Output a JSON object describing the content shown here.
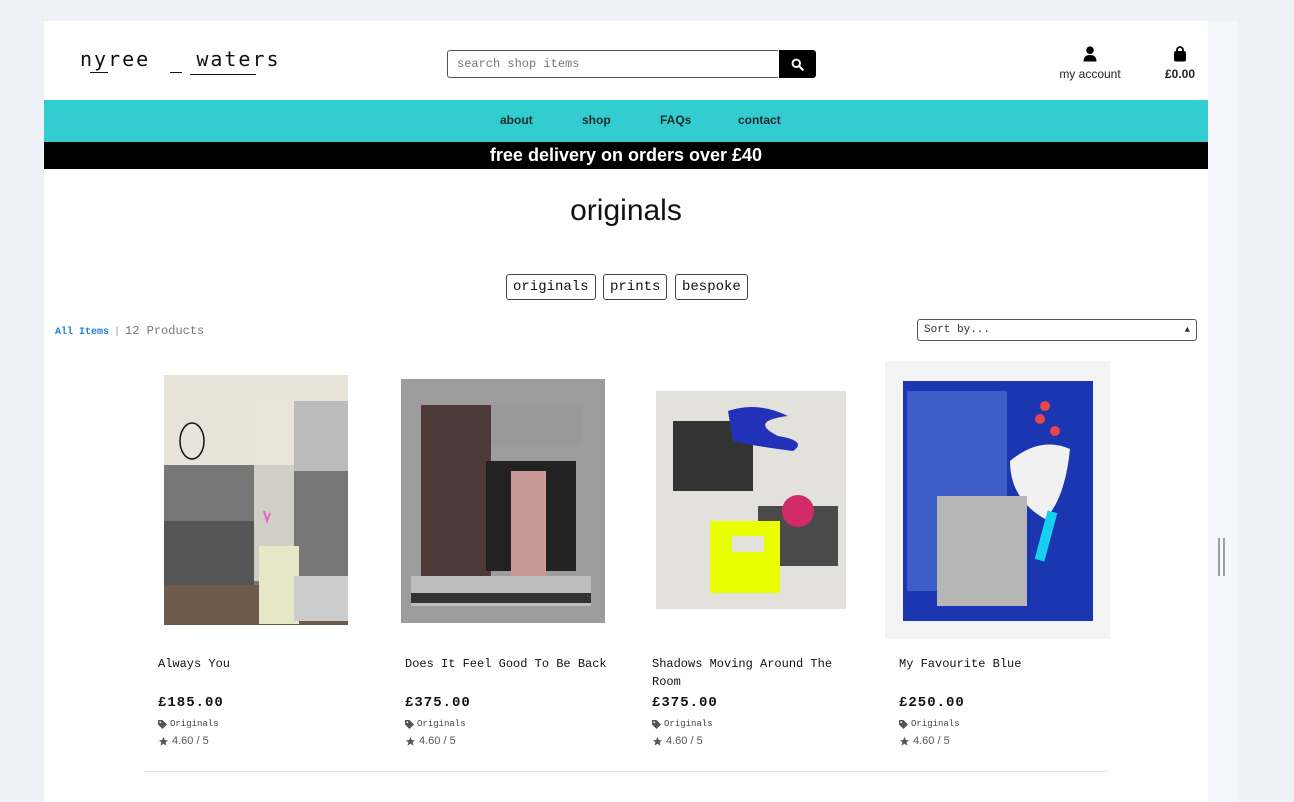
{
  "header": {
    "logo_line1": "nyree",
    "logo_line2": "waters",
    "search_placeholder": "search shop items",
    "account_label": "my account",
    "cart_total": "£0.00"
  },
  "nav": {
    "items": [
      "about",
      "shop",
      "FAQs",
      "contact"
    ]
  },
  "promo": "free delivery on orders over £40",
  "page_title": "originals",
  "categories": [
    "originals",
    "prints",
    "bespoke"
  ],
  "breadcrumb": {
    "all_label": "All Items",
    "count": "12 Products"
  },
  "sort": {
    "selected": "Sort by..."
  },
  "products": [
    {
      "name": "Always You",
      "price": "£185.00",
      "category": "Originals",
      "rating": "4.60 / 5"
    },
    {
      "name": "Does It Feel Good To Be Back",
      "price": "£375.00",
      "category": "Originals",
      "rating": "4.60 / 5"
    },
    {
      "name": "Shadows Moving Around The Room",
      "price": "£375.00",
      "category": "Originals",
      "rating": "4.60 / 5"
    },
    {
      "name": "My Favourite Blue",
      "price": "£250.00",
      "category": "Originals",
      "rating": "4.60 / 5"
    }
  ],
  "colors": {
    "nav_bg": "#33cdd1",
    "promo_bg": "#000000",
    "link": "#1f7fd8"
  },
  "icons": {
    "search": "search-icon",
    "account": "user-icon",
    "cart": "shopping-bag-icon",
    "tag": "tag-icon",
    "star": "star-icon"
  }
}
